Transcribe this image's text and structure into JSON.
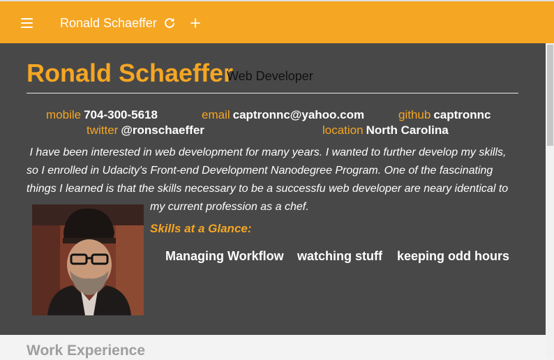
{
  "topbar": {
    "title": "Ronald Schaeffer",
    "accent_color": "#f5a623",
    "icons": [
      "menu-icon",
      "refresh-icon",
      "plus-icon"
    ]
  },
  "header": {
    "name": "Ronald Schaeffer",
    "role": "Web Developer"
  },
  "contacts": {
    "mobile": {
      "label": "mobile",
      "value": "704-300-5618"
    },
    "email": {
      "label": "email",
      "value": "captronnc@yahoo.com"
    },
    "github": {
      "label": "github",
      "value": "captronnc"
    },
    "twitter": {
      "label": "twitter",
      "value": "@ronschaeffer"
    },
    "location": {
      "label": "location",
      "value": "North Carolina"
    }
  },
  "bio": {
    "text": "I have been interested in web development for many years. I wanted to further develop my skills, so I enrolled in Udacity's Front-end Development Nanodegree Program. One of the fascinating things I learned is that the skills necessary to be a successfu web developer are neary identical to",
    "tail": "my current profession as a chef."
  },
  "skills": {
    "heading": "Skills at a Glance:",
    "items": [
      "Managing Workflow",
      "watching stuff",
      "keeping odd hours"
    ]
  },
  "work": {
    "heading": "Work Experience"
  },
  "colors": {
    "panel_bg": "#484848",
    "page_bg": "#f3f3f3",
    "heading_gray": "#9e9e9e"
  }
}
